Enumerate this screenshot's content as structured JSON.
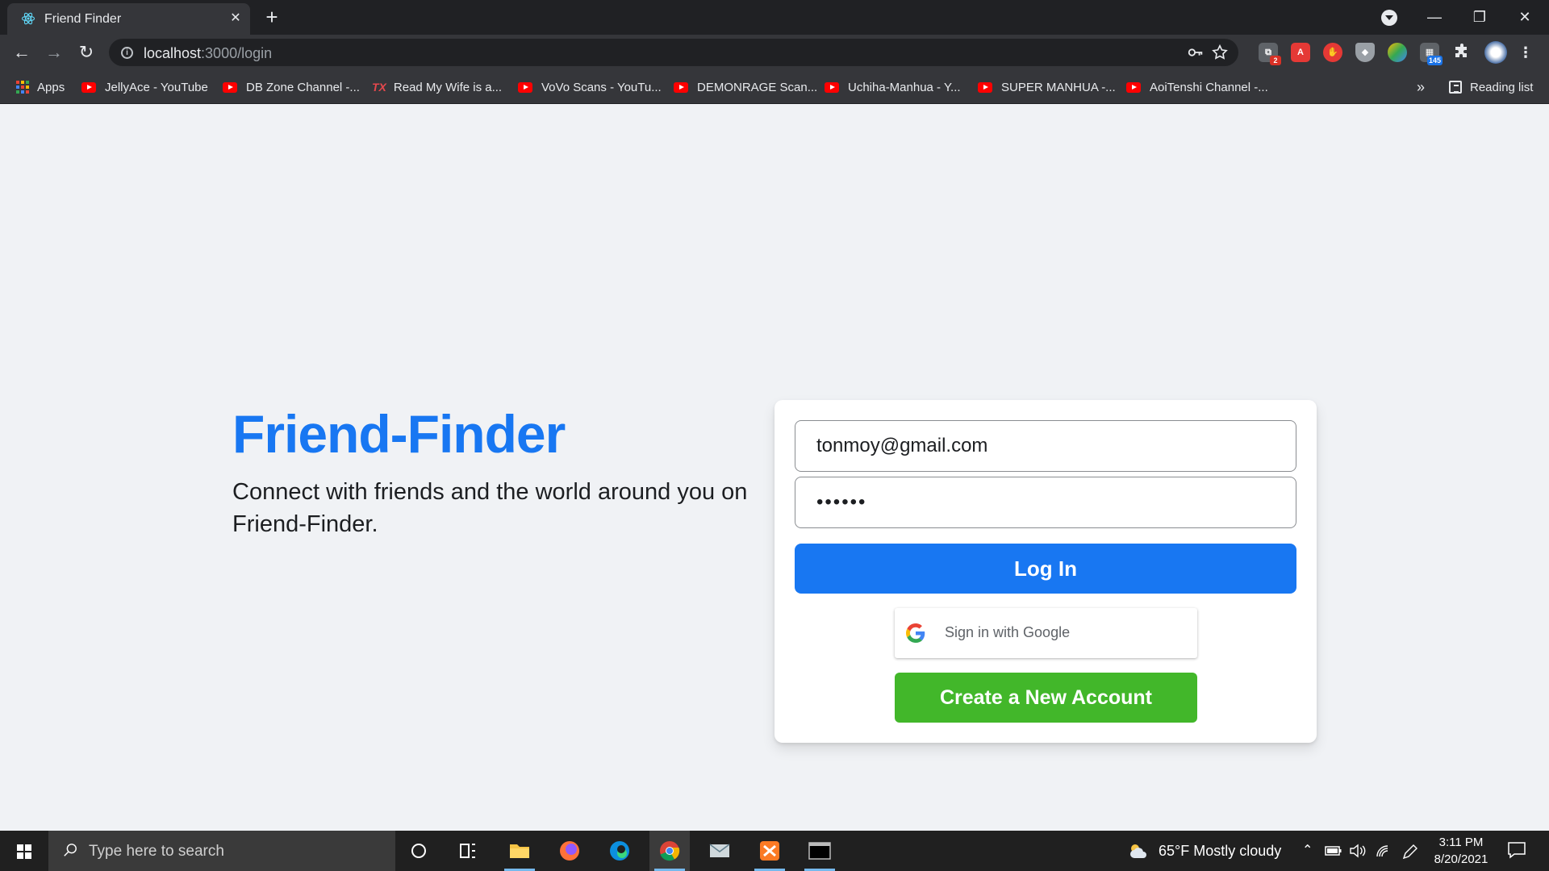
{
  "browser": {
    "tab_title": "Friend Finder",
    "close_tab_glyph": "✕",
    "new_tab_glyph": "+",
    "url_host": "localhost",
    "url_path": ":3000/login",
    "window_controls": {
      "minimize": "—",
      "restore": "❐",
      "close": "✕"
    }
  },
  "toolbar": {
    "back": "←",
    "forward": "→",
    "reload": "↻",
    "icons": [
      "key-icon",
      "star-icon",
      "extension-badge-icon",
      "acrobat-icon",
      "adblock-icon",
      "shield-icon",
      "colorful-ext-icon",
      "calendar-ext-icon",
      "puzzle-icon",
      "profile-avatar",
      "menu-icon"
    ],
    "ext_badges": {
      "first": "2",
      "calendar": "145"
    }
  },
  "bookmarks": {
    "apps": "Apps",
    "items": [
      "JellyAce - YouTube",
      "DB Zone Channel -...",
      "Read My Wife is a...",
      "VoVo Scans - YouTu...",
      "DEMONRAGE Scan...",
      "Uchiha-Manhua - Y...",
      "SUPER MANHUA -...",
      "AoiTenshi Channel -..."
    ],
    "overflow": "»",
    "reading_list": "Reading list"
  },
  "page": {
    "brand_title": "Friend-Finder",
    "tagline": "Connect with friends and the world around you on Friend-Finder.",
    "login": {
      "email_value": "tonmoy@gmail.com",
      "password_value": "••••••",
      "login_button": "Log In",
      "google_button": "Sign in with Google",
      "create_button": "Create a New Account"
    }
  },
  "taskbar": {
    "search_placeholder": "Type here to search",
    "weather": "65°F  Mostly cloudy",
    "time": "3:11 PM",
    "date": "8/20/2021"
  },
  "colors": {
    "brand_blue": "#1877f2",
    "create_green": "#42b72a",
    "page_bg": "#f0f2f5"
  }
}
